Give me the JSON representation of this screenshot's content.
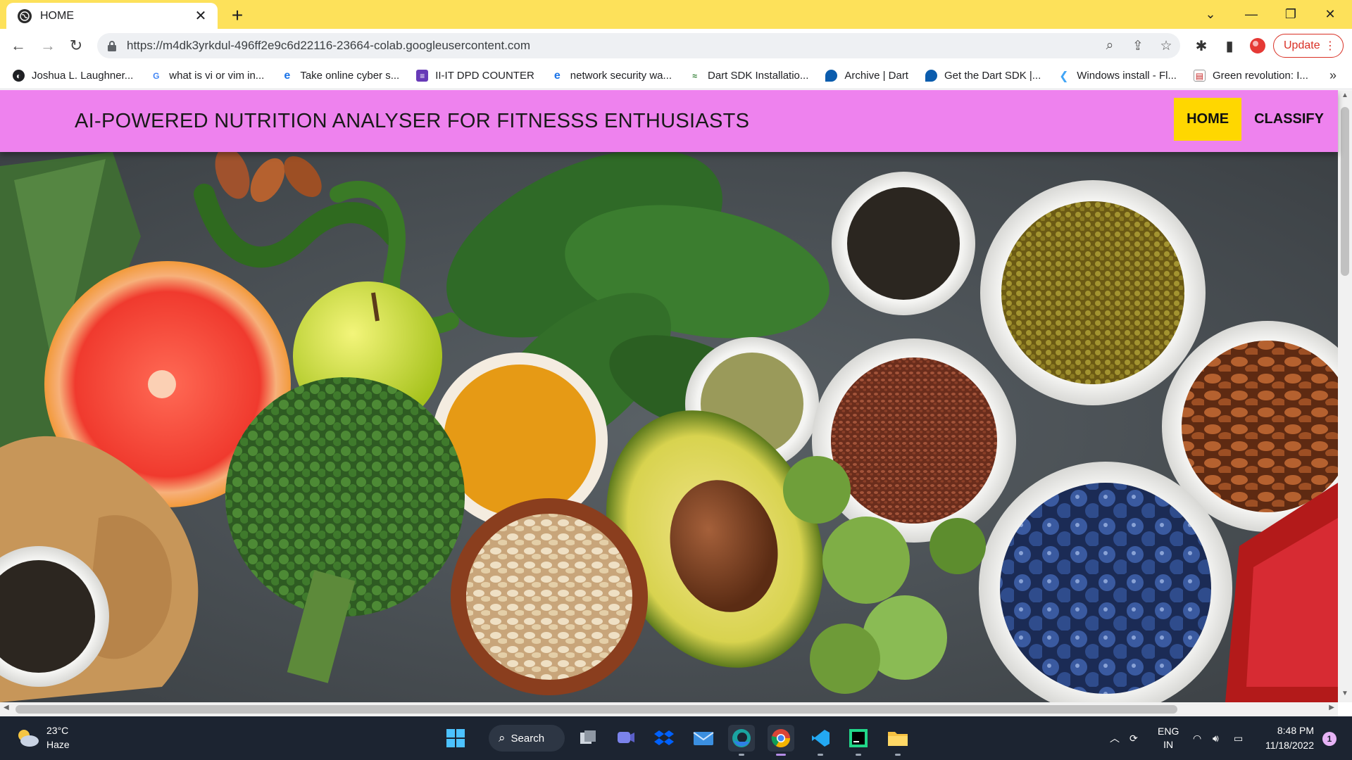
{
  "browser": {
    "tab_title": "HOME",
    "new_tab_symbol": "+",
    "url": "https://m4dk3yrkdul-496ff2e9c6d22116-23664-colab.googleusercontent.com",
    "update_label": "Update",
    "accent_color": "#fde15a"
  },
  "bookmarks": [
    {
      "label": "Joshua L. Laughner...",
      "icon": "globe-icon"
    },
    {
      "label": "what is vi or vim in...",
      "icon": "google-icon"
    },
    {
      "label": "Take online cyber s...",
      "icon": "edge-icon"
    },
    {
      "label": "II-IT DPD COUNTER",
      "icon": "forms-icon"
    },
    {
      "label": "network security wa...",
      "icon": "edge-icon"
    },
    {
      "label": "Dart SDK Installatio...",
      "icon": "dart-icon"
    },
    {
      "label": "Archive | Dart",
      "icon": "dart-icon"
    },
    {
      "label": "Get the Dart SDK |...",
      "icon": "dart-icon"
    },
    {
      "label": "Windows install - Fl...",
      "icon": "flutter-icon"
    },
    {
      "label": "Green revolution: I...",
      "icon": "page-icon"
    }
  ],
  "site": {
    "title": "AI-POWERED NUTRITION ANALYSER FOR FITNESSS ENTHUSIASTS",
    "nav": [
      {
        "label": "HOME",
        "active": true
      },
      {
        "label": "CLASSIFY",
        "active": false
      }
    ],
    "header_color": "#ee82ee",
    "active_nav_color": "#ffd700"
  },
  "taskbar": {
    "weather_temp": "23°C",
    "weather_desc": "Haze",
    "search_label": "Search",
    "lang_top": "ENG",
    "lang_bottom": "IN",
    "time": "8:48 PM",
    "date": "11/18/2022",
    "notification_count": "1"
  }
}
